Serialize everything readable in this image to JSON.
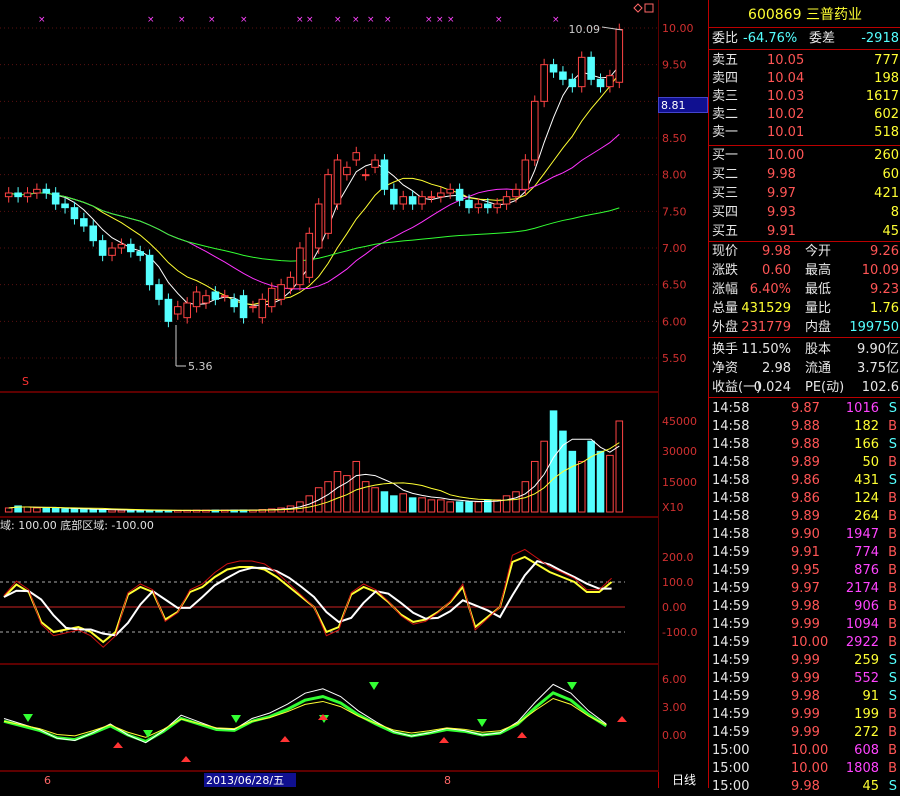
{
  "stock": {
    "code": "600869",
    "name": "三普药业"
  },
  "main_chart": {
    "price_axis": [
      "10.00",
      "9.50",
      "9.00",
      "8.50",
      "8.00",
      "7.50",
      "7.00",
      "6.50",
      "6.00",
      "5.50"
    ],
    "current_marker": "8.81",
    "high_label": "10.09",
    "low_label": "5.36",
    "s_mark": "S"
  },
  "volume_chart": {
    "axis": [
      "45000",
      "30000",
      "15000"
    ],
    "unit": "X10"
  },
  "osc_chart": {
    "header": "域: 100.00  底部区域: -100.00",
    "axis": [
      "200.0",
      "100.0",
      "0.00",
      "-100.0"
    ]
  },
  "kdj_chart": {
    "axis": [
      "6.00",
      "3.00",
      "0.00"
    ]
  },
  "x_axis": {
    "labels": [
      "6",
      "2013/06/28/五",
      "8"
    ],
    "period": "日线"
  },
  "quote": {
    "weibi": {
      "label": "委比",
      "value": "-64.76%"
    },
    "weicha": {
      "label": "委差",
      "value": "-2918"
    },
    "sell": [
      {
        "label": "卖五",
        "price": "10.05",
        "vol": "777"
      },
      {
        "label": "卖四",
        "price": "10.04",
        "vol": "198"
      },
      {
        "label": "卖三",
        "price": "10.03",
        "vol": "1617"
      },
      {
        "label": "卖二",
        "price": "10.02",
        "vol": "602"
      },
      {
        "label": "卖一",
        "price": "10.01",
        "vol": "518"
      }
    ],
    "buy": [
      {
        "label": "买一",
        "price": "10.00",
        "vol": "260"
      },
      {
        "label": "买二",
        "price": "9.98",
        "vol": "60"
      },
      {
        "label": "买三",
        "price": "9.97",
        "vol": "421"
      },
      {
        "label": "买四",
        "price": "9.93",
        "vol": "8"
      },
      {
        "label": "买五",
        "price": "9.91",
        "vol": "45"
      }
    ],
    "stats": [
      {
        "l1": "现价",
        "v1": "9.98",
        "l2": "今开",
        "v2": "9.26"
      },
      {
        "l1": "涨跌",
        "v1": "0.60",
        "l2": "最高",
        "v2": "10.09"
      },
      {
        "l1": "涨幅",
        "v1": "6.40%",
        "l2": "最低",
        "v2": "9.23"
      },
      {
        "l1": "总量",
        "v1": "431529",
        "l2": "量比",
        "v2": "1.76"
      },
      {
        "l1": "外盘",
        "v1": "231779",
        "l2": "内盘",
        "v2": "199750"
      }
    ],
    "fin": [
      {
        "l1": "换手",
        "v1": "11.50%",
        "l2": "股本",
        "v2": "9.90亿"
      },
      {
        "l1": "净资",
        "v1": "2.98",
        "l2": "流通",
        "v2": "3.75亿"
      },
      {
        "l1": "收益(一)",
        "v1": "0.024",
        "l2": "PE(动)",
        "v2": "102.6"
      }
    ]
  },
  "ticks": [
    {
      "t": "14:58",
      "p": "9.87",
      "v": "1016",
      "s": "S"
    },
    {
      "t": "14:58",
      "p": "9.88",
      "v": "182",
      "s": "B"
    },
    {
      "t": "14:58",
      "p": "9.88",
      "v": "166",
      "s": "S"
    },
    {
      "t": "14:58",
      "p": "9.89",
      "v": "50",
      "s": "B"
    },
    {
      "t": "14:58",
      "p": "9.86",
      "v": "431",
      "s": "S"
    },
    {
      "t": "14:58",
      "p": "9.86",
      "v": "124",
      "s": "B"
    },
    {
      "t": "14:58",
      "p": "9.89",
      "v": "264",
      "s": "B"
    },
    {
      "t": "14:58",
      "p": "9.90",
      "v": "1947",
      "s": "B"
    },
    {
      "t": "14:59",
      "p": "9.91",
      "v": "774",
      "s": "B"
    },
    {
      "t": "14:59",
      "p": "9.95",
      "v": "876",
      "s": "B"
    },
    {
      "t": "14:59",
      "p": "9.97",
      "v": "2174",
      "s": "B"
    },
    {
      "t": "14:59",
      "p": "9.98",
      "v": "906",
      "s": "B"
    },
    {
      "t": "14:59",
      "p": "9.99",
      "v": "1094",
      "s": "B"
    },
    {
      "t": "14:59",
      "p": "10.00",
      "v": "2922",
      "s": "B"
    },
    {
      "t": "14:59",
      "p": "9.99",
      "v": "259",
      "s": "S"
    },
    {
      "t": "14:59",
      "p": "9.99",
      "v": "552",
      "s": "S"
    },
    {
      "t": "14:59",
      "p": "9.98",
      "v": "91",
      "s": "S"
    },
    {
      "t": "14:59",
      "p": "9.99",
      "v": "199",
      "s": "B"
    },
    {
      "t": "14:59",
      "p": "9.99",
      "v": "272",
      "s": "B"
    },
    {
      "t": "15:00",
      "p": "10.00",
      "v": "608",
      "s": "B"
    },
    {
      "t": "15:00",
      "p": "10.00",
      "v": "1808",
      "s": "B"
    },
    {
      "t": "15:00",
      "p": "9.98",
      "v": "45",
      "s": "S"
    }
  ],
  "chart_data": {
    "type": "candlestick",
    "open": [
      7.7,
      7.75,
      7.7,
      7.75,
      7.8,
      7.75,
      7.6,
      7.55,
      7.4,
      7.3,
      7.1,
      6.9,
      7.0,
      7.05,
      6.95,
      6.9,
      6.5,
      6.3,
      6.1,
      6.05,
      6.2,
      6.25,
      6.4,
      6.35,
      6.3,
      6.35,
      6.2,
      6.05,
      6.2,
      6.3,
      6.45,
      6.5,
      6.6,
      7.0,
      7.2,
      7.6,
      8.0,
      8.2,
      8.0,
      8.1,
      8.2,
      7.8,
      7.6,
      7.7,
      7.6,
      7.7,
      7.7,
      7.75,
      7.8,
      7.65,
      7.55,
      7.6,
      7.55,
      7.6,
      7.7,
      7.8,
      8.2,
      9.0,
      9.5,
      9.4,
      9.3,
      9.2,
      9.6,
      9.3,
      9.2,
      9.26
    ],
    "close": [
      7.75,
      7.7,
      7.75,
      7.8,
      7.75,
      7.6,
      7.55,
      7.4,
      7.3,
      7.1,
      6.9,
      7.0,
      7.05,
      6.95,
      6.9,
      6.5,
      6.3,
      6.0,
      6.2,
      6.25,
      6.4,
      6.35,
      6.3,
      6.35,
      6.2,
      6.05,
      6.2,
      6.3,
      6.45,
      6.5,
      6.6,
      7.0,
      7.2,
      7.6,
      8.0,
      8.2,
      8.1,
      8.3,
      8.0,
      8.2,
      7.8,
      7.6,
      7.7,
      7.6,
      7.7,
      7.7,
      7.75,
      7.8,
      7.65,
      7.55,
      7.6,
      7.55,
      7.6,
      7.7,
      7.8,
      8.2,
      9.0,
      9.5,
      9.4,
      9.3,
      9.2,
      9.6,
      9.3,
      9.2,
      9.35,
      9.98
    ],
    "volume": [
      2000,
      3000,
      2500,
      2000,
      2000,
      1800,
      1500,
      1500,
      1200,
      1200,
      1000,
      1000,
      900,
      900,
      800,
      800,
      700,
      700,
      800,
      800,
      900,
      900,
      900,
      900,
      900,
      1000,
      1000,
      1200,
      1500,
      2000,
      3000,
      5000,
      8000,
      12000,
      15000,
      20000,
      18000,
      25000,
      15000,
      12000,
      10000,
      8000,
      9000,
      7000,
      7000,
      6000,
      6000,
      5000,
      5000,
      5000,
      5000,
      6000,
      6000,
      8000,
      10000,
      15000,
      25000,
      35000,
      50000,
      40000,
      30000,
      25000,
      35000,
      30000,
      28000,
      45000
    ],
    "osc": [
      40,
      90,
      60,
      -60,
      -100,
      -90,
      -80,
      -100,
      -140,
      -100,
      50,
      80,
      60,
      -50,
      -20,
      60,
      80,
      120,
      150,
      160,
      160,
      150,
      120,
      80,
      40,
      0,
      -100,
      -80,
      50,
      80,
      60,
      20,
      -30,
      -60,
      -50,
      -20,
      20,
      80,
      -80,
      -40,
      0,
      180,
      200,
      170,
      140,
      120,
      100,
      60,
      60,
      100
    ],
    "kdj": [
      1.5,
      1.0,
      0.5,
      -0.3,
      -0.5,
      0.2,
      1.0,
      0.0,
      -0.7,
      0.4,
      1.8,
      1.2,
      0.6,
      0.5,
      1.5,
      2.0,
      2.8,
      3.8,
      4.2,
      3.5,
      2.2,
      1.2,
      0.3,
      -0.1,
      0.2,
      0.6,
      0.4,
      0.0,
      0.2,
      1.2,
      3.0,
      4.6,
      3.8,
      2.2,
      1.0
    ]
  }
}
